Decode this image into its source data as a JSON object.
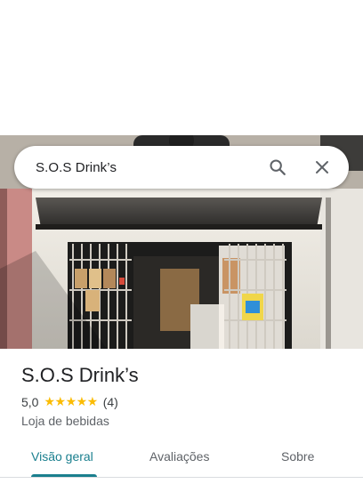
{
  "search": {
    "query": "S.O.S Drink’s",
    "search_icon": "search-icon",
    "close_icon": "close-icon"
  },
  "place": {
    "name": "S.O.S Drink’s",
    "rating": "5,0",
    "stars": "★★★★★",
    "review_count": "(4)",
    "category": "Loja de bebidas"
  },
  "tabs": [
    {
      "label": "Visão geral",
      "active": true
    },
    {
      "label": "Avaliações"
    },
    {
      "label": "Sobre"
    }
  ],
  "colors": {
    "accent": "#1a7f8e",
    "star": "#fbbc04"
  }
}
